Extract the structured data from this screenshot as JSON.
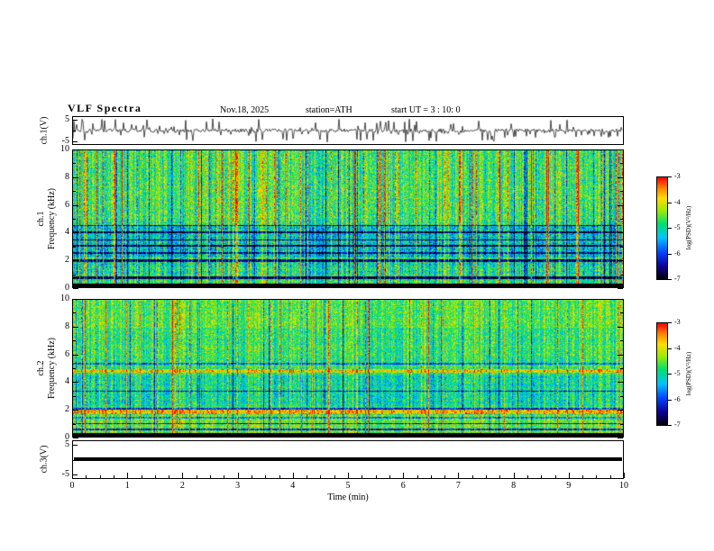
{
  "header": {
    "title": "VLF  Spectra",
    "date": "Nov.18, 2025",
    "station": "station=ATH",
    "start_ut": "start UT =  3 : 10: 0"
  },
  "xaxis": {
    "label": "Time  (min)",
    "ticks": [
      0,
      1,
      2,
      3,
      4,
      5,
      6,
      7,
      8,
      9,
      10
    ],
    "xlim": [
      0,
      10
    ]
  },
  "colorbar": {
    "label": "log(PSD)(V²/Hz)",
    "ticks": [
      -3,
      -4,
      -5,
      -6,
      -7
    ],
    "range": [
      -7,
      -3
    ]
  },
  "colormap_stops": [
    [
      0.0,
      0,
      0,
      0
    ],
    [
      0.13,
      15,
      0,
      150
    ],
    [
      0.27,
      0,
      70,
      255
    ],
    [
      0.41,
      0,
      195,
      255
    ],
    [
      0.55,
      0,
      225,
      110
    ],
    [
      0.68,
      160,
      235,
      0
    ],
    [
      0.8,
      255,
      220,
      0
    ],
    [
      0.9,
      255,
      130,
      0
    ],
    [
      1.0,
      255,
      0,
      0
    ]
  ],
  "chart_data": [
    {
      "type": "line",
      "name": "ch1_waveform",
      "ylabel": "ch.1(V)",
      "ylim": [
        -5,
        5
      ],
      "yticks": [
        5,
        -5
      ],
      "xlim": [
        0,
        10
      ],
      "description": "Broadband noisy VLF time series centered near 0 V with frequent impulsive sferic spikes toward ±5 V over the full 10 minutes",
      "render": {
        "seed": 11,
        "amp": 1.8,
        "spike_p": 0.22,
        "spike_amp": 11,
        "down_bias": 0.6
      }
    },
    {
      "type": "heatmap",
      "name": "ch1_spectrogram",
      "ylabel_ch": "ch.1",
      "ylabel_freq": "Frequency (kHz)",
      "ylim": [
        0,
        10
      ],
      "yticks": [
        0,
        2,
        4,
        6,
        8,
        10
      ],
      "xlim": [
        0,
        10
      ],
      "value_range": [
        -7,
        -3
      ],
      "description": "Speckled green background PSD near -5, dense red/yellow vertical sferic streaks, bluer band 2-4.6 kHz with dark horizontal interference lines, black band below 0.3 kHz",
      "render": {
        "seed": 7,
        "base": 0.55,
        "noise": 0.34,
        "red_streak_p": 0.1,
        "red_streak_amp": 0.25,
        "dark_streak_p": 0.08,
        "dark_streak_amp": 0.2,
        "col_jitter": 0.13,
        "bands": [
          [
            0,
            0.3,
            -10
          ],
          [
            0.65,
            0.85,
            -0.5
          ],
          [
            1.0,
            1.9,
            -0.05
          ],
          [
            1.9,
            2.05,
            -0.45
          ],
          [
            2.2,
            4.6,
            -0.12
          ],
          [
            2.5,
            2.6,
            -0.3
          ],
          [
            3.0,
            3.1,
            -0.4
          ],
          [
            3.45,
            3.55,
            -0.4
          ],
          [
            4.0,
            4.1,
            -0.4
          ],
          [
            4.5,
            4.6,
            -0.35
          ],
          [
            5.0,
            10,
            0.03
          ]
        ]
      }
    },
    {
      "type": "heatmap",
      "name": "ch2_spectrogram",
      "ylabel_ch": "ch.2",
      "ylabel_freq": "Frequency (kHz)",
      "ylim": [
        0,
        10
      ],
      "yticks": [
        0,
        2,
        4,
        6,
        8,
        10
      ],
      "xlim": [
        0,
        10
      ],
      "value_range": [
        -7,
        -3
      ],
      "description": "Mostly uniform green/cyan PSD with yellow-orange horizontal band near 1.7-2 kHz, fainter bright band near 4.8 kHz, sparse vertical streaks, black band below 0.3 kHz",
      "render": {
        "seed": 23,
        "base": 0.56,
        "noise": 0.3,
        "red_streak_p": 0.06,
        "red_streak_amp": 0.18,
        "dark_streak_p": 0.05,
        "dark_streak_amp": 0.18,
        "col_jitter": 0.11,
        "bands": [
          [
            0,
            0.28,
            -10
          ],
          [
            0.3,
            1.6,
            0.08
          ],
          [
            0.5,
            0.62,
            -0.45
          ],
          [
            0.95,
            1.05,
            -0.5
          ],
          [
            1.35,
            1.45,
            -0.3
          ],
          [
            1.65,
            2.0,
            0.28
          ],
          [
            2.02,
            2.12,
            -0.35
          ],
          [
            2.3,
            4.5,
            -0.06
          ],
          [
            3.3,
            3.4,
            -0.3
          ],
          [
            4.7,
            4.95,
            0.22
          ],
          [
            5.3,
            5.4,
            -0.25
          ],
          [
            8.0,
            10,
            0.05
          ]
        ]
      }
    },
    {
      "type": "line",
      "name": "ch3_flatline",
      "ylabel": "ch.3(V)",
      "ylim": [
        -5,
        5
      ],
      "yticks": [
        5,
        -5
      ],
      "value": 0,
      "description": "Constant 0 V signal drawn as a thick solid black horizontal line (channel inactive)"
    }
  ]
}
